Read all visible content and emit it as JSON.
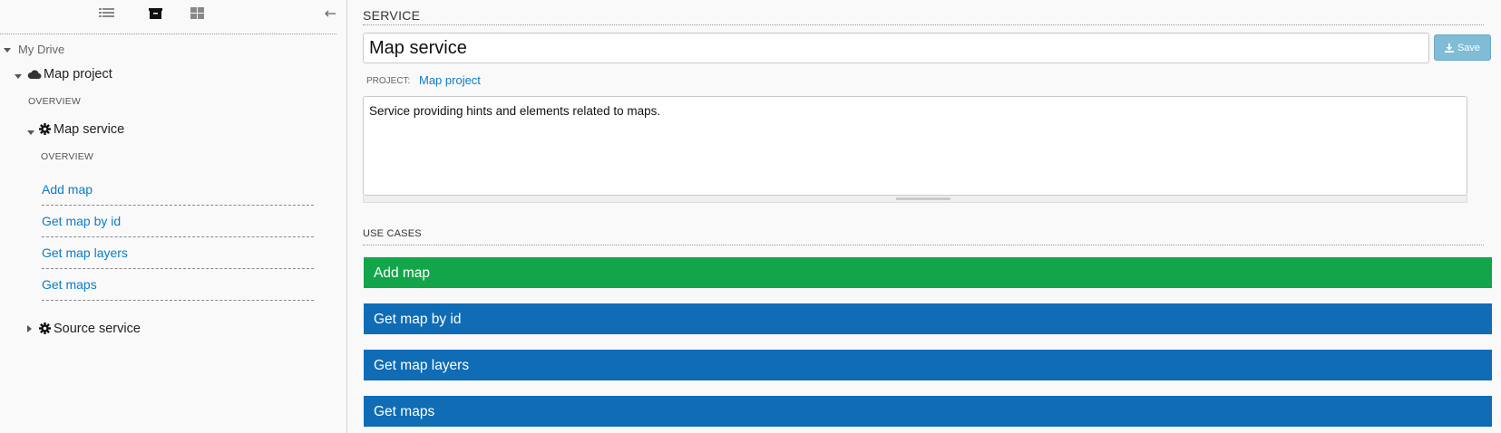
{
  "colors": {
    "link": "#0b7cc9",
    "usecase_selected": "#13a54a",
    "usecase_default": "#0f6cb5",
    "save_button": "#7fbdd6"
  },
  "toolbar": {
    "buttons": [
      {
        "icon": "list-icon"
      },
      {
        "icon": "archive-icon"
      },
      {
        "icon": "grid-icon"
      },
      {
        "icon": "collapse-arrow-icon"
      }
    ]
  },
  "tree": {
    "root": "My Drive",
    "project": {
      "icon": "cloud-icon",
      "label": "Map project",
      "overview": "OVERVIEW",
      "services": [
        {
          "icon": "gear-icon",
          "label": "Map service",
          "expanded": true,
          "overview": "OVERVIEW",
          "use_cases": [
            "Add map",
            "Get map by id",
            "Get map layers",
            "Get maps"
          ]
        },
        {
          "icon": "gear-icon",
          "label": "Source service",
          "expanded": false
        }
      ]
    }
  },
  "main": {
    "section_title": "SERVICE",
    "name_value": "Map service",
    "save_label": "Save",
    "save_icon": "download-icon",
    "project_label": "PROJECT:",
    "project_link": "Map project",
    "description": "Service providing hints and elements related to maps.",
    "use_cases_title": "USE CASES",
    "use_cases": [
      {
        "label": "Add map",
        "selected": true
      },
      {
        "label": "Get map by id",
        "selected": false
      },
      {
        "label": "Get map layers",
        "selected": false
      },
      {
        "label": "Get maps",
        "selected": false
      }
    ]
  }
}
